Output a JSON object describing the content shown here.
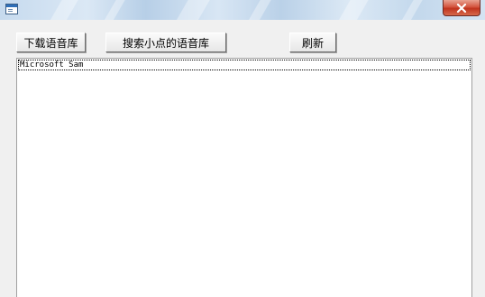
{
  "window": {
    "title": "",
    "icon": "application-window-icon",
    "close_icon": "close-x-icon",
    "close_color": "#c7402a"
  },
  "toolbar": {
    "download_label": "下载语音库",
    "search_label": "搜索小点的语音库",
    "refresh_label": "刷新"
  },
  "voice_list": {
    "items": [
      {
        "label": "Microsoft Sam",
        "selected": true
      }
    ]
  }
}
